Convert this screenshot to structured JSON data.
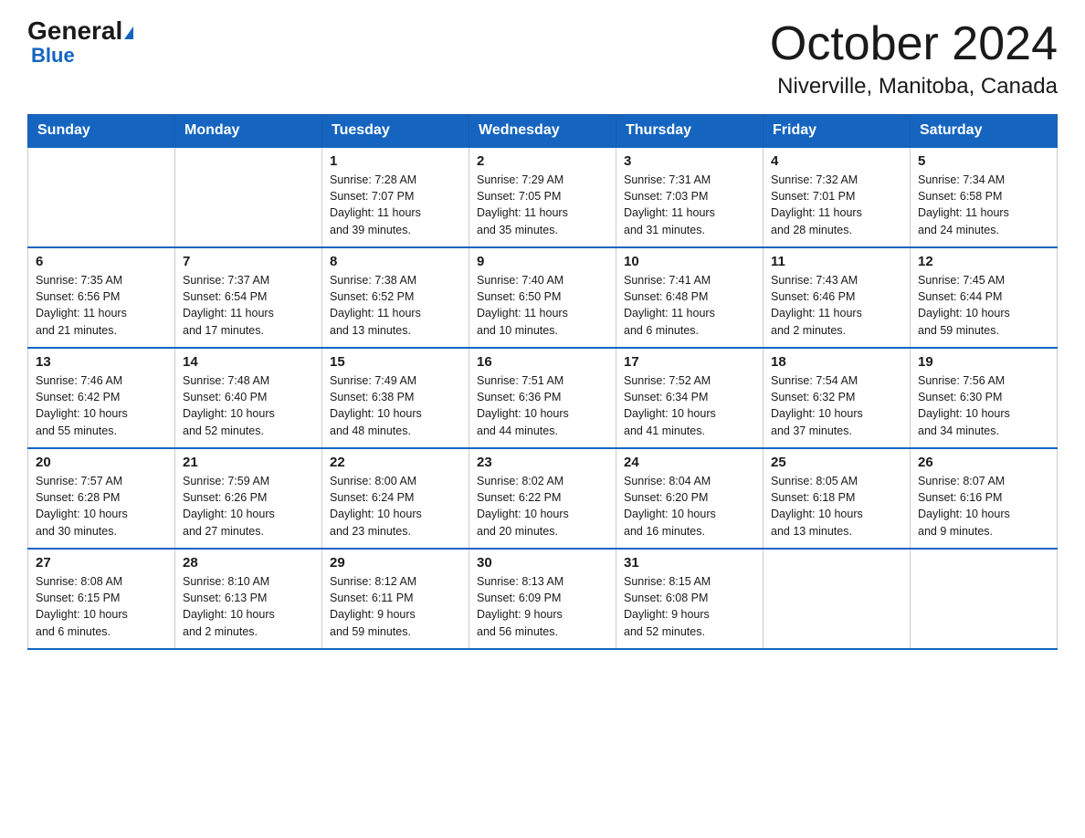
{
  "logo": {
    "line1_general": "General",
    "line1_blue": "Blue",
    "line2": "Blue"
  },
  "header": {
    "month": "October 2024",
    "location": "Niverville, Manitoba, Canada"
  },
  "days_of_week": [
    "Sunday",
    "Monday",
    "Tuesday",
    "Wednesday",
    "Thursday",
    "Friday",
    "Saturday"
  ],
  "weeks": [
    [
      {
        "day": "",
        "info": ""
      },
      {
        "day": "",
        "info": ""
      },
      {
        "day": "1",
        "info": "Sunrise: 7:28 AM\nSunset: 7:07 PM\nDaylight: 11 hours\nand 39 minutes."
      },
      {
        "day": "2",
        "info": "Sunrise: 7:29 AM\nSunset: 7:05 PM\nDaylight: 11 hours\nand 35 minutes."
      },
      {
        "day": "3",
        "info": "Sunrise: 7:31 AM\nSunset: 7:03 PM\nDaylight: 11 hours\nand 31 minutes."
      },
      {
        "day": "4",
        "info": "Sunrise: 7:32 AM\nSunset: 7:01 PM\nDaylight: 11 hours\nand 28 minutes."
      },
      {
        "day": "5",
        "info": "Sunrise: 7:34 AM\nSunset: 6:58 PM\nDaylight: 11 hours\nand 24 minutes."
      }
    ],
    [
      {
        "day": "6",
        "info": "Sunrise: 7:35 AM\nSunset: 6:56 PM\nDaylight: 11 hours\nand 21 minutes."
      },
      {
        "day": "7",
        "info": "Sunrise: 7:37 AM\nSunset: 6:54 PM\nDaylight: 11 hours\nand 17 minutes."
      },
      {
        "day": "8",
        "info": "Sunrise: 7:38 AM\nSunset: 6:52 PM\nDaylight: 11 hours\nand 13 minutes."
      },
      {
        "day": "9",
        "info": "Sunrise: 7:40 AM\nSunset: 6:50 PM\nDaylight: 11 hours\nand 10 minutes."
      },
      {
        "day": "10",
        "info": "Sunrise: 7:41 AM\nSunset: 6:48 PM\nDaylight: 11 hours\nand 6 minutes."
      },
      {
        "day": "11",
        "info": "Sunrise: 7:43 AM\nSunset: 6:46 PM\nDaylight: 11 hours\nand 2 minutes."
      },
      {
        "day": "12",
        "info": "Sunrise: 7:45 AM\nSunset: 6:44 PM\nDaylight: 10 hours\nand 59 minutes."
      }
    ],
    [
      {
        "day": "13",
        "info": "Sunrise: 7:46 AM\nSunset: 6:42 PM\nDaylight: 10 hours\nand 55 minutes."
      },
      {
        "day": "14",
        "info": "Sunrise: 7:48 AM\nSunset: 6:40 PM\nDaylight: 10 hours\nand 52 minutes."
      },
      {
        "day": "15",
        "info": "Sunrise: 7:49 AM\nSunset: 6:38 PM\nDaylight: 10 hours\nand 48 minutes."
      },
      {
        "day": "16",
        "info": "Sunrise: 7:51 AM\nSunset: 6:36 PM\nDaylight: 10 hours\nand 44 minutes."
      },
      {
        "day": "17",
        "info": "Sunrise: 7:52 AM\nSunset: 6:34 PM\nDaylight: 10 hours\nand 41 minutes."
      },
      {
        "day": "18",
        "info": "Sunrise: 7:54 AM\nSunset: 6:32 PM\nDaylight: 10 hours\nand 37 minutes."
      },
      {
        "day": "19",
        "info": "Sunrise: 7:56 AM\nSunset: 6:30 PM\nDaylight: 10 hours\nand 34 minutes."
      }
    ],
    [
      {
        "day": "20",
        "info": "Sunrise: 7:57 AM\nSunset: 6:28 PM\nDaylight: 10 hours\nand 30 minutes."
      },
      {
        "day": "21",
        "info": "Sunrise: 7:59 AM\nSunset: 6:26 PM\nDaylight: 10 hours\nand 27 minutes."
      },
      {
        "day": "22",
        "info": "Sunrise: 8:00 AM\nSunset: 6:24 PM\nDaylight: 10 hours\nand 23 minutes."
      },
      {
        "day": "23",
        "info": "Sunrise: 8:02 AM\nSunset: 6:22 PM\nDaylight: 10 hours\nand 20 minutes."
      },
      {
        "day": "24",
        "info": "Sunrise: 8:04 AM\nSunset: 6:20 PM\nDaylight: 10 hours\nand 16 minutes."
      },
      {
        "day": "25",
        "info": "Sunrise: 8:05 AM\nSunset: 6:18 PM\nDaylight: 10 hours\nand 13 minutes."
      },
      {
        "day": "26",
        "info": "Sunrise: 8:07 AM\nSunset: 6:16 PM\nDaylight: 10 hours\nand 9 minutes."
      }
    ],
    [
      {
        "day": "27",
        "info": "Sunrise: 8:08 AM\nSunset: 6:15 PM\nDaylight: 10 hours\nand 6 minutes."
      },
      {
        "day": "28",
        "info": "Sunrise: 8:10 AM\nSunset: 6:13 PM\nDaylight: 10 hours\nand 2 minutes."
      },
      {
        "day": "29",
        "info": "Sunrise: 8:12 AM\nSunset: 6:11 PM\nDaylight: 9 hours\nand 59 minutes."
      },
      {
        "day": "30",
        "info": "Sunrise: 8:13 AM\nSunset: 6:09 PM\nDaylight: 9 hours\nand 56 minutes."
      },
      {
        "day": "31",
        "info": "Sunrise: 8:15 AM\nSunset: 6:08 PM\nDaylight: 9 hours\nand 52 minutes."
      },
      {
        "day": "",
        "info": ""
      },
      {
        "day": "",
        "info": ""
      }
    ]
  ]
}
